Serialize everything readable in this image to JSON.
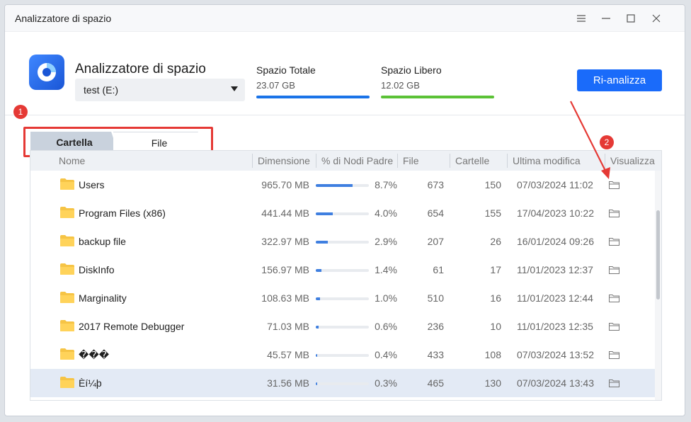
{
  "window": {
    "title": "Analizzatore di spazio"
  },
  "header": {
    "app_title": "Analizzatore di spazio",
    "drive": "test (E:)",
    "total": {
      "label": "Spazio Totale",
      "value": "23.07 GB",
      "color": "#1a73e8"
    },
    "free": {
      "label": "Spazio Libero",
      "value": "12.02 GB",
      "color": "#5bc236"
    },
    "reanalyze_label": "Ri-analizza"
  },
  "annotations": {
    "badge1": "1",
    "badge2": "2"
  },
  "tabs": {
    "folder": "Cartella",
    "file": "File"
  },
  "table": {
    "columns": {
      "name": "Nome",
      "size": "Dimensione",
      "pct": "% di Nodi Padre",
      "files": "File",
      "folders": "Cartelle",
      "modified": "Ultima modifica",
      "view": "Visualizza"
    },
    "rows": [
      {
        "name": "Users",
        "size": "965.70 MB",
        "pct": "8.7%",
        "pct_value": 8.7,
        "files": "673",
        "folders": "150",
        "modified": "07/03/2024 11:02"
      },
      {
        "name": "Program Files (x86)",
        "size": "441.44 MB",
        "pct": "4.0%",
        "pct_value": 4.0,
        "files": "654",
        "folders": "155",
        "modified": "17/04/2023 10:22"
      },
      {
        "name": "backup file",
        "size": "322.97 MB",
        "pct": "2.9%",
        "pct_value": 2.9,
        "files": "207",
        "folders": "26",
        "modified": "16/01/2024 09:26"
      },
      {
        "name": "DiskInfo",
        "size": "156.97 MB",
        "pct": "1.4%",
        "pct_value": 1.4,
        "files": "61",
        "folders": "17",
        "modified": "11/01/2023 12:37"
      },
      {
        "name": "Marginality",
        "size": "108.63 MB",
        "pct": "1.0%",
        "pct_value": 1.0,
        "files": "510",
        "folders": "16",
        "modified": "11/01/2023 12:44"
      },
      {
        "name": "2017 Remote Debugger",
        "size": "71.03 MB",
        "pct": "0.6%",
        "pct_value": 0.6,
        "files": "236",
        "folders": "10",
        "modified": "11/01/2023 12:35"
      },
      {
        "name": "���",
        "size": "45.57 MB",
        "pct": "0.4%",
        "pct_value": 0.4,
        "files": "433",
        "folders": "108",
        "modified": "07/03/2024 13:52"
      },
      {
        "name": "Èí¼þ",
        "size": "31.56 MB",
        "pct": "0.3%",
        "pct_value": 0.3,
        "files": "465",
        "folders": "130",
        "modified": "07/03/2024 13:43"
      }
    ]
  }
}
